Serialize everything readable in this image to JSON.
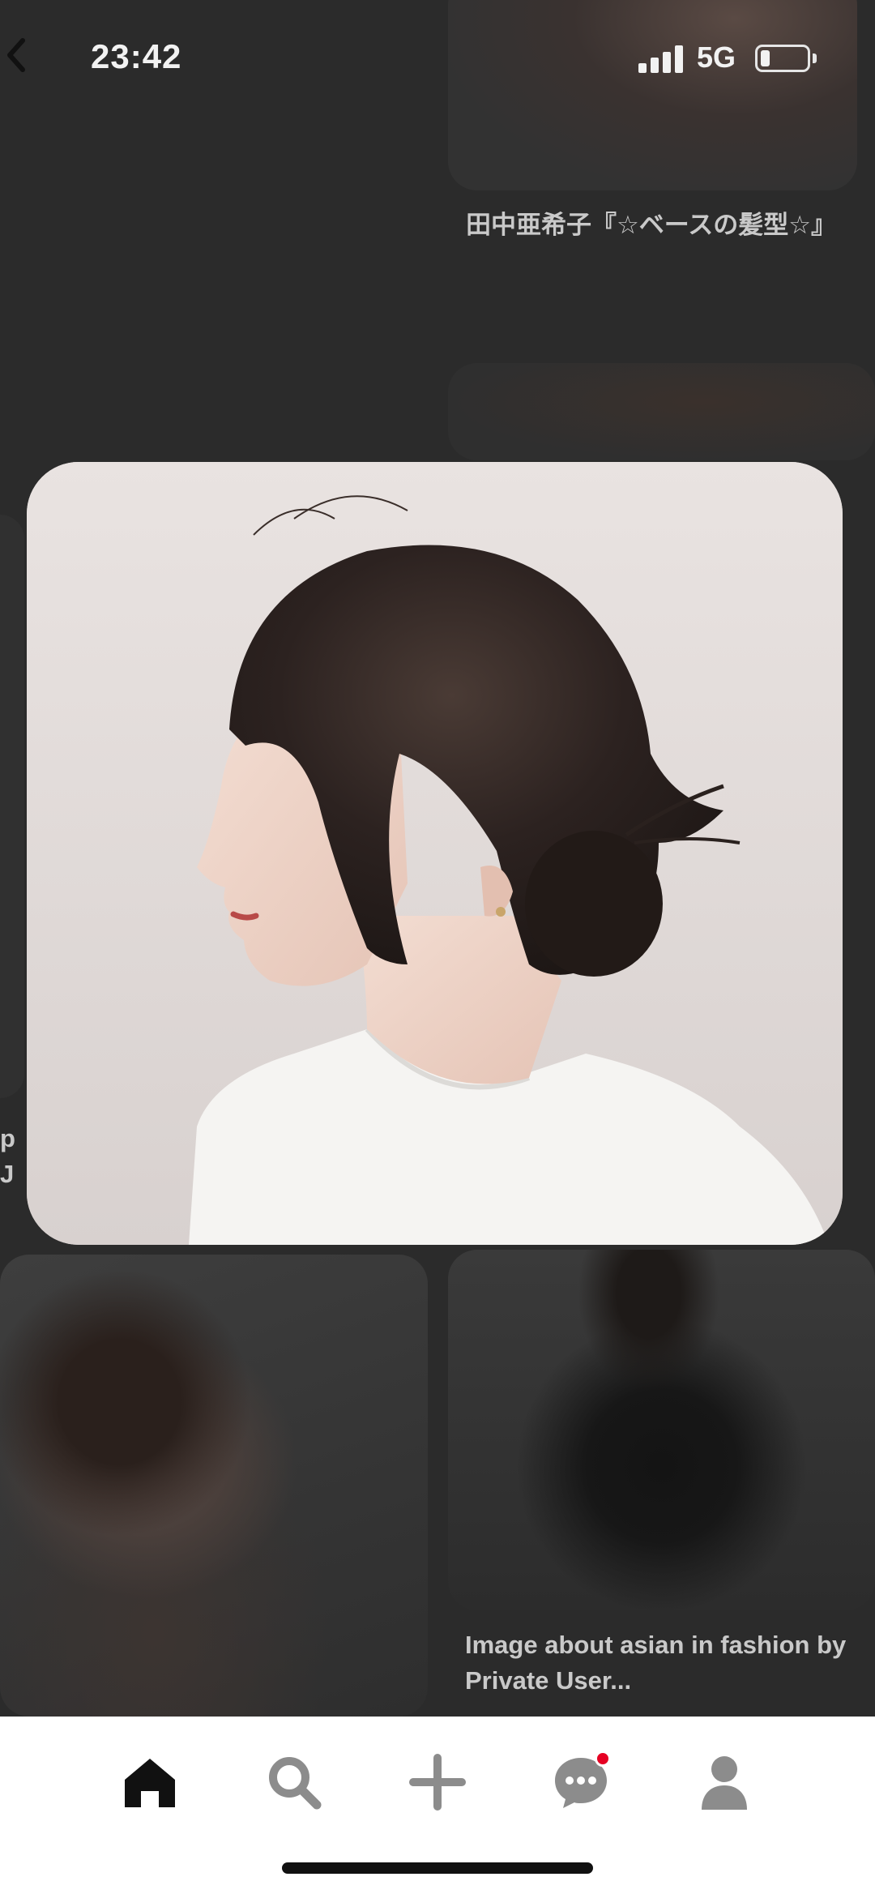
{
  "status_bar": {
    "time": "23:42",
    "network": "5G",
    "battery_level": 0.2
  },
  "feed": {
    "pins": [
      {
        "caption": "田中亜希子『☆ベースの髪型☆』"
      },
      {
        "caption": "Image about asian in fashion by Private User..."
      }
    ],
    "left_fragment_caption": "p\nJ"
  },
  "popup": {
    "image_alt": "woman with low bun hairstyle in profile wearing a white t-shirt"
  },
  "bottom_nav": {
    "items": [
      {
        "icon": "home-icon"
      },
      {
        "icon": "search-icon"
      },
      {
        "icon": "plus-icon"
      },
      {
        "icon": "messages-icon",
        "has_notification": true
      },
      {
        "icon": "profile-icon"
      }
    ],
    "accent_color": "#e60023"
  }
}
